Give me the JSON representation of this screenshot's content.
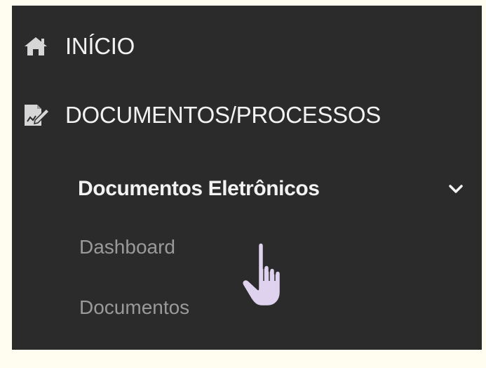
{
  "nav": {
    "home_label": "INÍCIO",
    "documents_label": "DOCUMENTOS/PROCESSOS"
  },
  "submenu": {
    "header_label": "Documentos Eletrônicos",
    "items": [
      {
        "label": "Dashboard"
      },
      {
        "label": "Documentos"
      }
    ]
  },
  "icons": {
    "home": "home-icon",
    "documents": "document-edit-icon",
    "chevron": "chevron-down-icon",
    "cursor": "pointer-hand-icon"
  },
  "colors": {
    "page_background": "#fefdf0",
    "sidebar_background": "#2b2b2b",
    "primary_text": "#f2f2f2",
    "muted_text": "#9a9a9a",
    "cursor_fill": "#ded2ee"
  }
}
